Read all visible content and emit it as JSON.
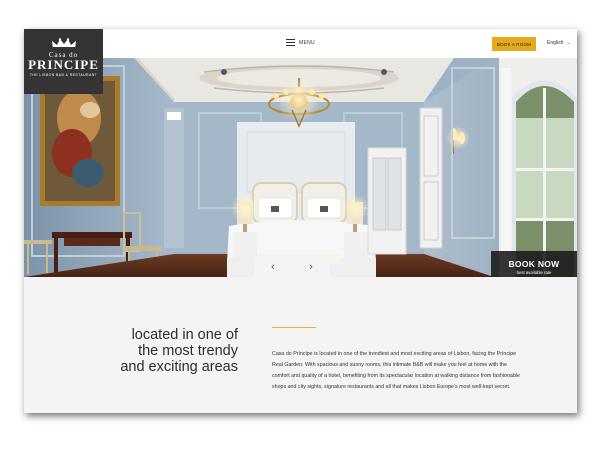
{
  "logo": {
    "line1": "Casa do",
    "line2": "PRINCIPE",
    "line3": "THE LISBON B&B & RESTAURANT"
  },
  "nav": {
    "menu_label": "MENU",
    "book_button": "BOOK A ROOM",
    "language": "English"
  },
  "hero": {
    "book_now_title": "BOOK NOW",
    "book_now_subtitle": "best available rate",
    "prev_arrow": "‹",
    "next_arrow": "›"
  },
  "content": {
    "headline": "located in one of the most trendy and exciting areas",
    "paragraph": "Casa do Príncipe is located in one of the trendiest and most exciting areas of Lisbon, facing the Príncipe Real Garden. With spacious and sunny rooms, this intimate B&B will make you feel at home with the comfort and quality of a hotel, benefiting from its spectacular location at walking distance from fashionable shops and city sights, signature restaurants and all that makes Lisbon Europe's most well-kept secret."
  },
  "colors": {
    "accent": "#e6a91d",
    "logo_bg": "#343434",
    "wall": "#9db2c4"
  }
}
